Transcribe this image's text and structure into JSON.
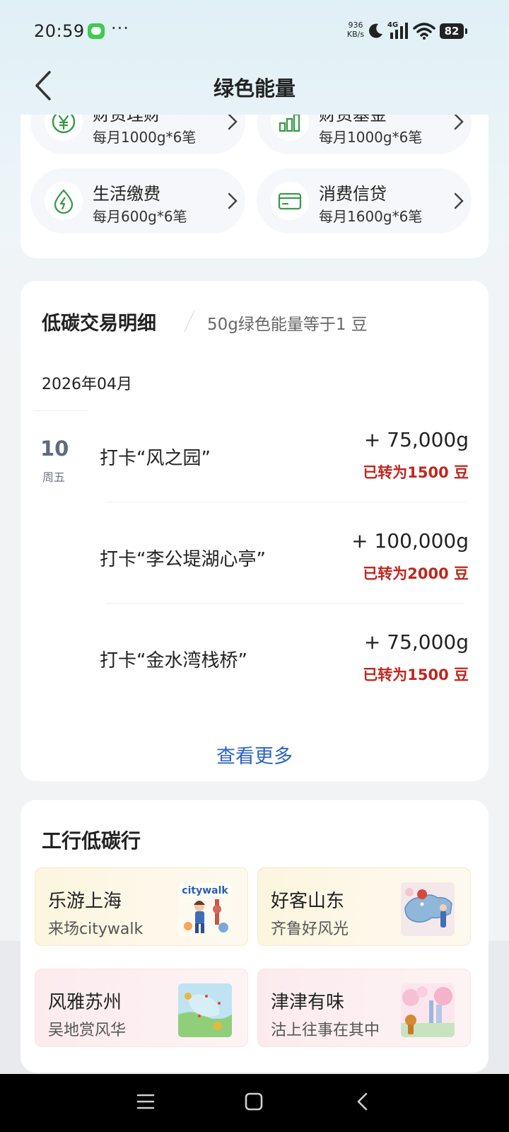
{
  "status_bar": {
    "time": "20:59",
    "more": "···",
    "net_speed_value": "936",
    "net_speed_unit": "KB/s",
    "network_type": "4G",
    "battery": "82"
  },
  "header": {
    "title": "绿色能量"
  },
  "services": [
    {
      "title": "财资理财",
      "sub": "每月1000g*6笔",
      "icon": "yen-icon"
    },
    {
      "title": "财资基金",
      "sub": "每月1000g*6笔",
      "icon": "bar-chart-icon"
    },
    {
      "title": "生活缴费",
      "sub": "每月600g*6笔",
      "icon": "energy-leaf-icon"
    },
    {
      "title": "消费信贷",
      "sub": "每月1600g*6笔",
      "icon": "credit-card-icon"
    }
  ],
  "transactions": {
    "title": "低碳交易明细",
    "subtitle": "50g绿色能量等于1 豆",
    "month": "2026年04月",
    "day": "10",
    "weekday": "周五",
    "items": [
      {
        "name": "打卡“风之园”",
        "amount": "+ 75,000g",
        "converted": "已转为1500 豆"
      },
      {
        "name": "打卡“李公堤湖心亭”",
        "amount": "+ 100,000g",
        "converted": "已转为2000 豆"
      },
      {
        "name": "打卡“金水湾栈桥”",
        "amount": "+ 75,000g",
        "converted": "已转为1500 豆"
      }
    ],
    "view_more": "查看更多"
  },
  "low_carbon": {
    "title": "工行低碳行",
    "promos": [
      {
        "title": "乐游上海",
        "sub": "来场citywalk",
        "thumb_text": "citywalk",
        "style": "yellow"
      },
      {
        "title": "好客山东",
        "sub": "齐鲁好风光",
        "style": "yellow"
      },
      {
        "title": "风雅苏州",
        "sub": "吴地赏风华",
        "style": "pink"
      },
      {
        "title": "津津有味",
        "sub": "沽上往事在其中",
        "style": "pink"
      }
    ]
  },
  "colors": {
    "accent_green": "#3a9a4a",
    "converted_red": "#c0271e",
    "link_blue": "#2e63c4"
  }
}
